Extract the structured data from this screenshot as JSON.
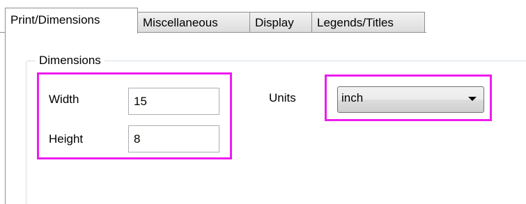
{
  "tabs": [
    {
      "label": "Print/Dimensions",
      "active": true
    },
    {
      "label": "Miscellaneous",
      "active": false
    },
    {
      "label": "Display",
      "active": false
    },
    {
      "label": "Legends/Titles",
      "active": false
    }
  ],
  "dimensions_group": {
    "title": "Dimensions",
    "width": {
      "label": "Width",
      "value": "15"
    },
    "height": {
      "label": "Height",
      "value": "8"
    },
    "units": {
      "label": "Units",
      "selected": "inch"
    }
  },
  "colors": {
    "highlight": "#ee1cee",
    "tab_border": "#8e8f8f",
    "group_border": "#d5dfe5"
  },
  "icons": {
    "units_dropdown_arrow": "chevron-down-icon"
  }
}
